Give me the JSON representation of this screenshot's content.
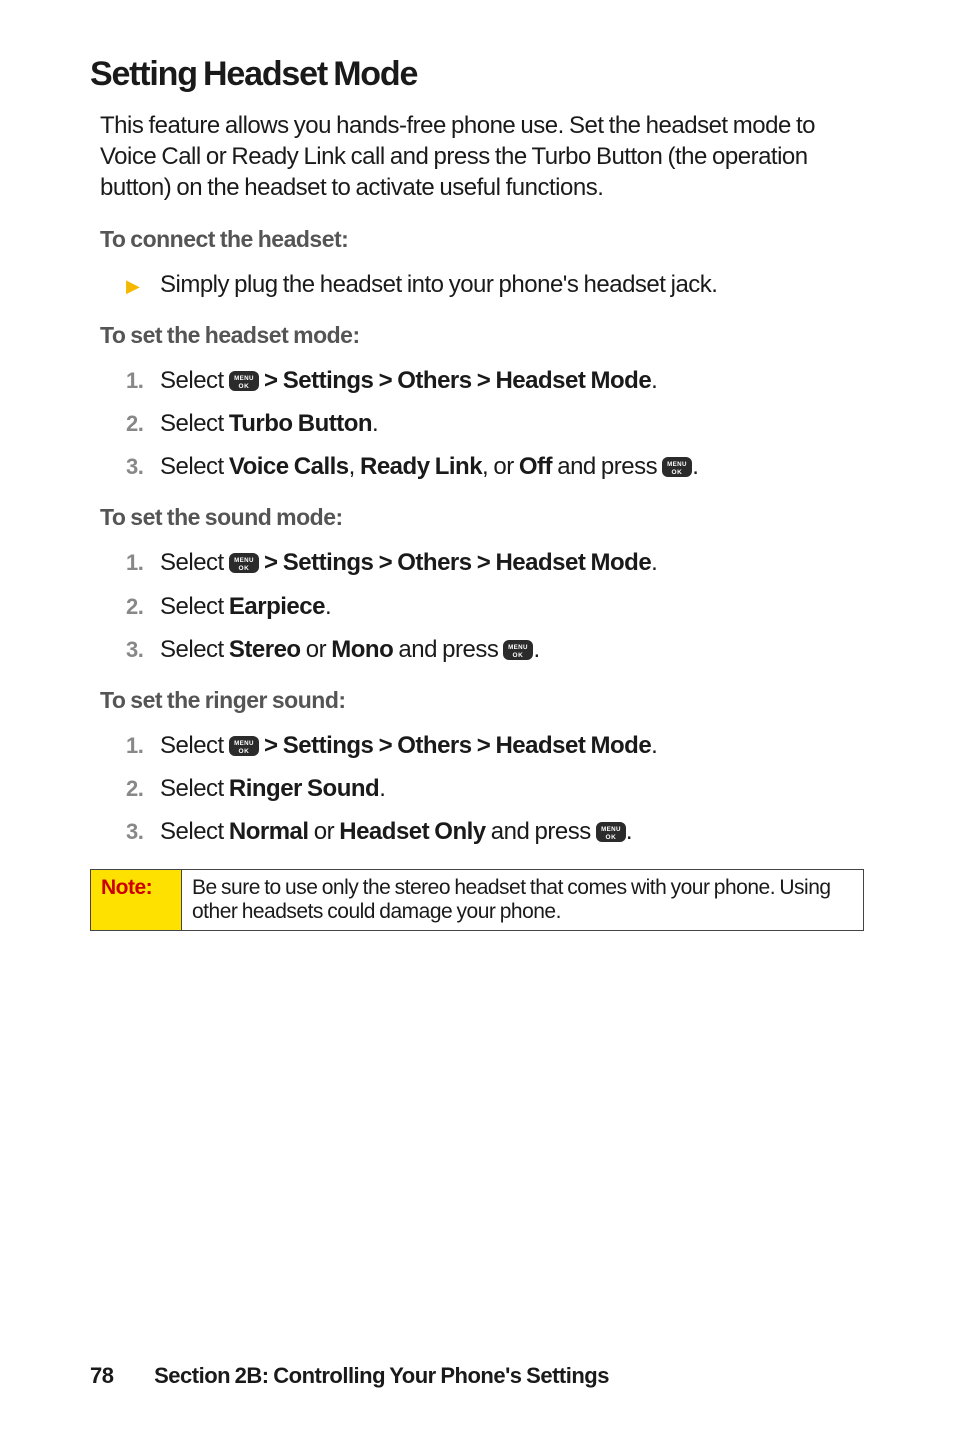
{
  "heading": "Setting Headset Mode",
  "intro": "This feature allows you hands-free phone use. Set the headset mode to Voice Call or Ready Link call and press the Turbo Button (the operation button) on the headset to activate useful functions.",
  "connect": {
    "subhead": "To connect the headset:",
    "bullet": "Simply plug the headset into your phone's headset jack."
  },
  "headset_mode": {
    "subhead": "To set the headset mode:",
    "steps": [
      {
        "prefix": "Select ",
        "bold": " > Settings > Others > Headset Mode",
        "suffix": "."
      },
      {
        "prefix": "Select ",
        "bold": "Turbo Button",
        "suffix": "."
      },
      {
        "prefix": "Select ",
        "bold": "Voice Calls",
        "mid1": ", ",
        "bold2": "Ready Link",
        "mid2": ", or ",
        "bold3": "Off",
        "mid3": " and press ",
        "suffix": "."
      }
    ]
  },
  "sound_mode": {
    "subhead": "To set the sound mode:",
    "steps": [
      {
        "prefix": "Select ",
        "bold": " > Settings > Others > Headset Mode",
        "suffix": "."
      },
      {
        "prefix": "Select ",
        "bold": "Earpiece",
        "suffix": "."
      },
      {
        "prefix": "Select ",
        "bold": "Stereo",
        "mid1": " or ",
        "bold2": "Mono",
        "mid2": " and press ",
        "suffix": "."
      }
    ]
  },
  "ringer": {
    "subhead": "To set the ringer sound:",
    "steps": [
      {
        "prefix": "Select ",
        "bold": " > Settings > Others > Headset Mode",
        "suffix": "."
      },
      {
        "prefix": "Select ",
        "bold": "Ringer Sound",
        "suffix": "."
      },
      {
        "prefix": "Select ",
        "bold": "Normal",
        "mid1": " or ",
        "bold2": "Headset Only",
        "mid2": " and press ",
        "suffix": "."
      }
    ]
  },
  "note": {
    "label": "Note:",
    "text": "Be sure to use only the stereo headset that comes with your phone. Using other headsets could damage your phone."
  },
  "footer": {
    "page": "78",
    "section": "Section 2B: Controlling Your Phone's Settings"
  },
  "icon_label": "MENU OK"
}
